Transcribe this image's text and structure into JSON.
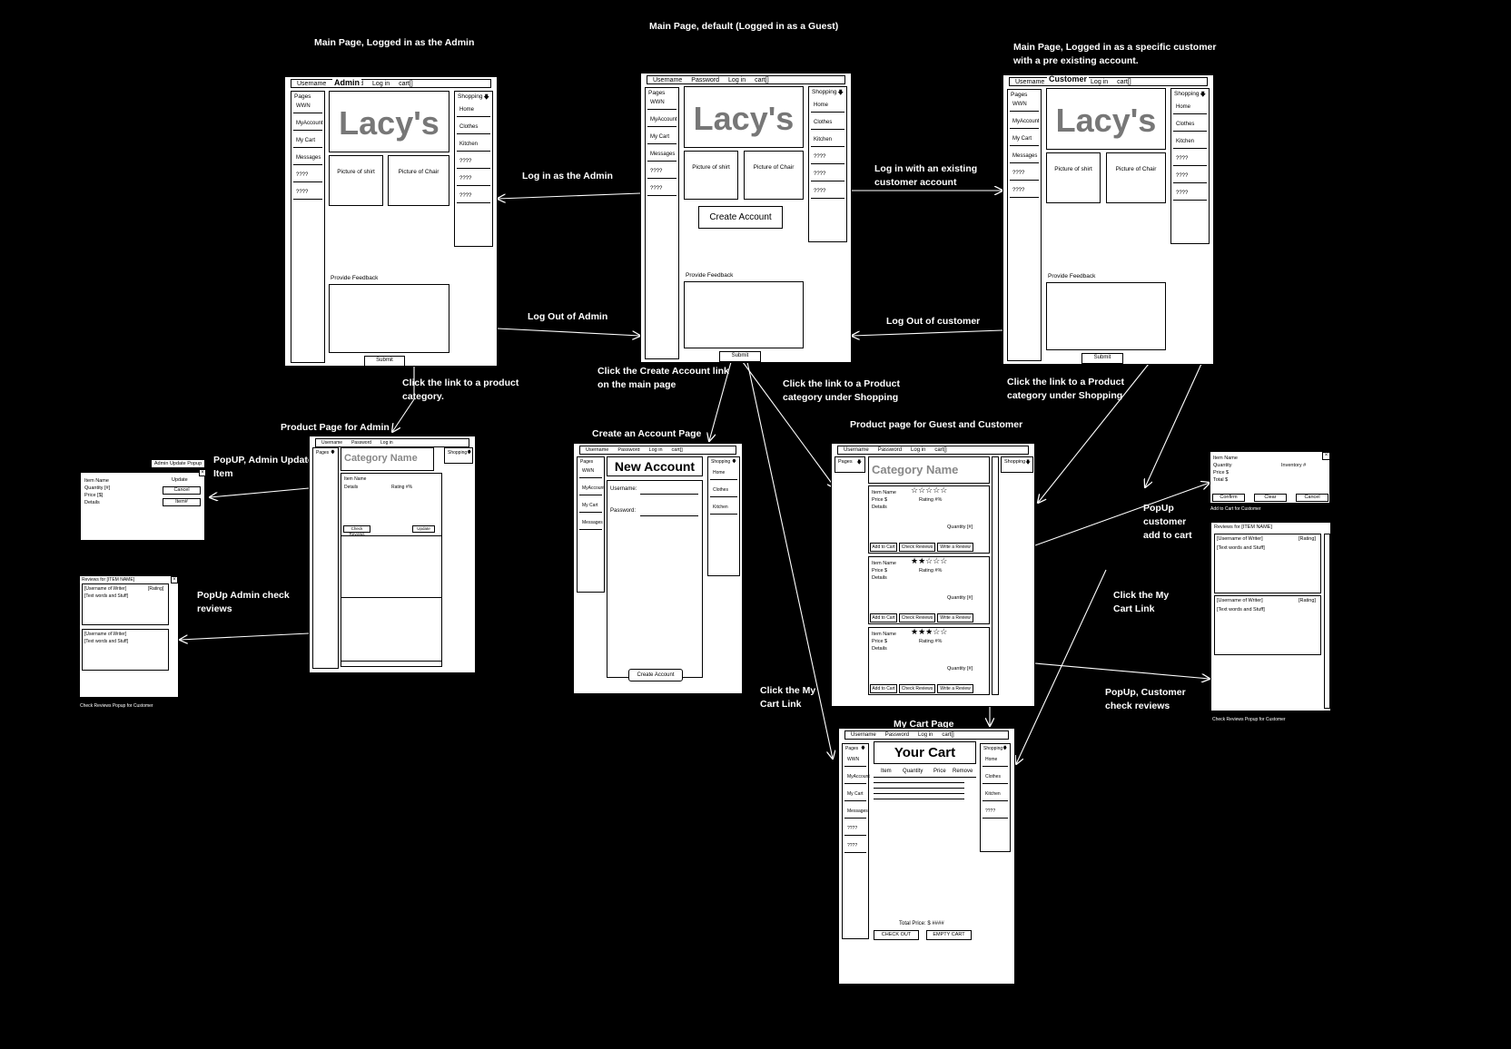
{
  "labels": {
    "main_admin": "Main Page, Logged in as the Admin",
    "main_guest": "Main Page, default (Logged in as a Guest)",
    "main_customer_1": "Main Page, Logged in as a specific customer",
    "main_customer_2": "with a pre existing account.",
    "login_admin": "Log in as the Admin",
    "logout_admin": "Log Out of Admin",
    "login_customer_1": "Log in with an existing",
    "login_customer_2": "customer account",
    "logout_customer": "Log Out of customer",
    "click_product_admin_1": "Click the link to a product",
    "click_product_admin_2": "category.",
    "click_create_1": "Click the Create Account link",
    "click_create_2": "on the main page",
    "click_product_guest_1": "Click the link to a Product",
    "click_product_guest_2": "category under Shopping",
    "click_product_cust_1": "Click the link to a Product",
    "click_product_cust_2": "category under Shopping",
    "product_admin": "Product Page for Admin",
    "create_account_page": "Create an Account Page",
    "product_guest_customer": "Product page for Guest and Customer",
    "popup_admin_update_1": "PopUP, Admin Update",
    "popup_admin_update_2": "Item",
    "popup_admin_reviews_1": "PopUp Admin check",
    "popup_admin_reviews_2": "reviews",
    "popup_cust_add_1": "PopUp",
    "popup_cust_add_2": "customer",
    "popup_cust_add_3": "add to cart",
    "click_mycart_1": "Click the My",
    "click_mycart_2": "Cart Link",
    "click_mycart_left_1": "Click the My",
    "click_mycart_left_2": "Cart Link",
    "popup_cust_reviews_1": "PopUp, Customer",
    "popup_cust_reviews_2": "check reviews",
    "my_cart_page": "My Cart Page"
  },
  "screens": {
    "top": {
      "username": "Username",
      "password": "Password",
      "login": "Log in",
      "cart": "cart[]"
    },
    "left_menu": {
      "head": "Pages",
      "items": [
        "WWN",
        "MyAccount",
        "My Cart",
        "Messages",
        "????",
        "????"
      ]
    },
    "right_menu": {
      "head": "Shopping",
      "items": [
        "Home",
        "Clothes",
        "Kitchen",
        "????",
        "????",
        "????"
      ]
    },
    "brand": "Lacy's",
    "picture_shirt": "Picture of shirt",
    "picture_chair": "Picture of Chair",
    "create_account_btn": "Create Account",
    "feedback": "Provide Feedback",
    "submit": "Submit",
    "admin_badge": "Admin",
    "customer_badge": "Customer",
    "category_name": "Category Name",
    "item_name": "Item Name",
    "price": "Price $",
    "details": "Details",
    "rating": "Rating #%",
    "quantity": "Quantity [#]",
    "add_to_cart": "Add to Cart",
    "check_reviews": "Check Reviews",
    "write_review": "Write a Review",
    "update": "Update",
    "new_account": "New Account",
    "username_field": "Username:",
    "password_field": "Password:",
    "create_account_small": "Create Account",
    "your_cart": "Your Cart",
    "cart_cols": [
      "Item",
      "Quantity",
      "Price",
      "Remove"
    ],
    "total_price": "Total Price: $ ####",
    "check_out": "CHECK OUT",
    "empty_cart": "EMPTY CART",
    "admin_popup_title": "Admin Update Popup",
    "admin_popup_fields": [
      "Item Name",
      "Quantity [#]",
      "Price [$]",
      "Details"
    ],
    "admin_popup_update": "Update",
    "admin_popup_cancel": "Cancel",
    "admin_popup_field": "Item#",
    "reviews_title": "Reviews for [ITEM NAME]",
    "review_user": "[Username of Writer]",
    "review_rating": "[Rating]",
    "review_text": "[Text words and Stuff]",
    "reviews_caption": "Check Reviews Popup for Customer",
    "add_popup_fields": [
      "Item Name",
      "Quantity",
      "Price $",
      "Total $"
    ],
    "add_popup_inventory": "Inventory #",
    "add_popup_confirm": "Confirm",
    "add_popup_clear": "Clear",
    "add_popup_cancel": "Cancel",
    "add_popup_caption": "Add to Cart for Customer"
  }
}
